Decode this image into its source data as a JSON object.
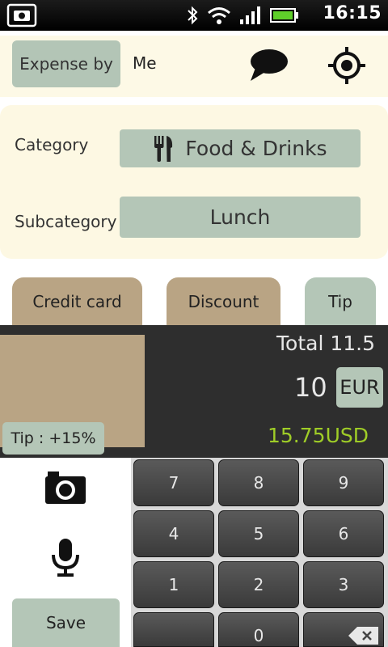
{
  "status": {
    "time": "16:15",
    "icons": [
      "screenshot-icon",
      "bluetooth-icon",
      "wifi-icon",
      "signal-icon",
      "battery-icon"
    ]
  },
  "header": {
    "expense_by_label": "Expense by",
    "expense_by_value": "Me",
    "icons": [
      "chat-bubble-icon",
      "gps-target-icon"
    ]
  },
  "category": {
    "category_label": "Category",
    "category_value": "Food & Drinks",
    "category_icon": "fork-knife-icon",
    "subcategory_label": "Subcategory",
    "subcategory_value": "Lunch"
  },
  "tabs": [
    {
      "label": "Credit card"
    },
    {
      "label": "Discount"
    },
    {
      "label": "Tip"
    }
  ],
  "summary": {
    "total": "Total 11.5",
    "amount": "10",
    "currency": "EUR",
    "converted": "15.75USD",
    "tip_badge": "Tip : +15%"
  },
  "actions": {
    "save_label": "Save",
    "camera_icon": "camera-icon",
    "mic_icon": "microphone-icon"
  },
  "keypad": {
    "keys": [
      "7",
      "8",
      "9",
      "4",
      "5",
      "6",
      "1",
      "2",
      "3",
      "",
      "0",
      ""
    ]
  },
  "colors": {
    "button_green": "#b4c6b7",
    "tab_brown": "#b9a484",
    "panel_cream": "#fdf8e3",
    "converted_green": "#9fcd27",
    "dark_panel": "#2e2e2e"
  }
}
